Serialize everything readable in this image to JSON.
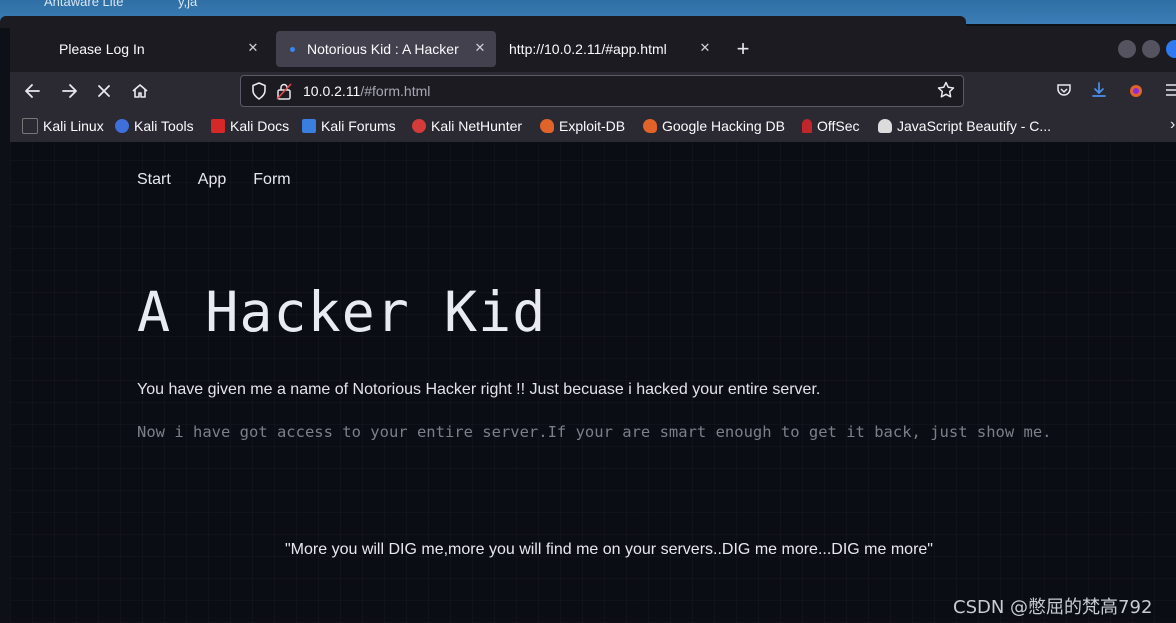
{
  "browser": {
    "tabs": [
      {
        "label": "Please Log In",
        "active": false
      },
      {
        "label": "Notorious Kid : A Hacker",
        "active": true
      },
      {
        "label": "http://10.0.2.11/#app.html",
        "active": false
      }
    ],
    "tab_close_glyph": "✕",
    "new_tab_glyph": "+",
    "url": {
      "host": "10.0.2.11",
      "path": "/#form.html"
    },
    "bookmarks": [
      {
        "label": "Kali Linux",
        "icon": "kali-dragon-icon",
        "color": "#1b1b1b"
      },
      {
        "label": "Kali Tools",
        "icon": "kali-tools-icon",
        "color": "#3f6fd8"
      },
      {
        "label": "Kali Docs",
        "icon": "kali-docs-icon",
        "color": "#d62828"
      },
      {
        "label": "Kali Forums",
        "icon": "kali-forums-icon",
        "color": "#3a7fe0"
      },
      {
        "label": "Kali NetHunter",
        "icon": "nethunter-icon",
        "color": "#d43b3b"
      },
      {
        "label": "Exploit-DB",
        "icon": "exploit-db-icon",
        "color": "#e0632a"
      },
      {
        "label": "Google Hacking DB",
        "icon": "ghdb-icon",
        "color": "#e0632a"
      },
      {
        "label": "OffSec",
        "icon": "offsec-icon",
        "color": "#c0262b"
      },
      {
        "label": "JavaScript Beautify - C...",
        "icon": "js-beautify-icon",
        "color": "#dcdcdc"
      }
    ],
    "accent": "#2f7af0"
  },
  "desktop": {
    "left_text": "Antaware Lite",
    "right_text": "y,ja"
  },
  "site": {
    "nav": [
      "Start",
      "App",
      "Form"
    ],
    "title": "A Hacker Kid",
    "lead": "You have given me a name of Notorious Hacker right !! Just becuase i hacked your entire server.",
    "note": "Now i have got access to your entire server.If your are smart enough to get it back, just show me.",
    "quote": "\"More you will DIG me,more you will find me on your servers..DIG me more...DIG me more\""
  },
  "watermark": "CSDN @憋屈的梵高792"
}
